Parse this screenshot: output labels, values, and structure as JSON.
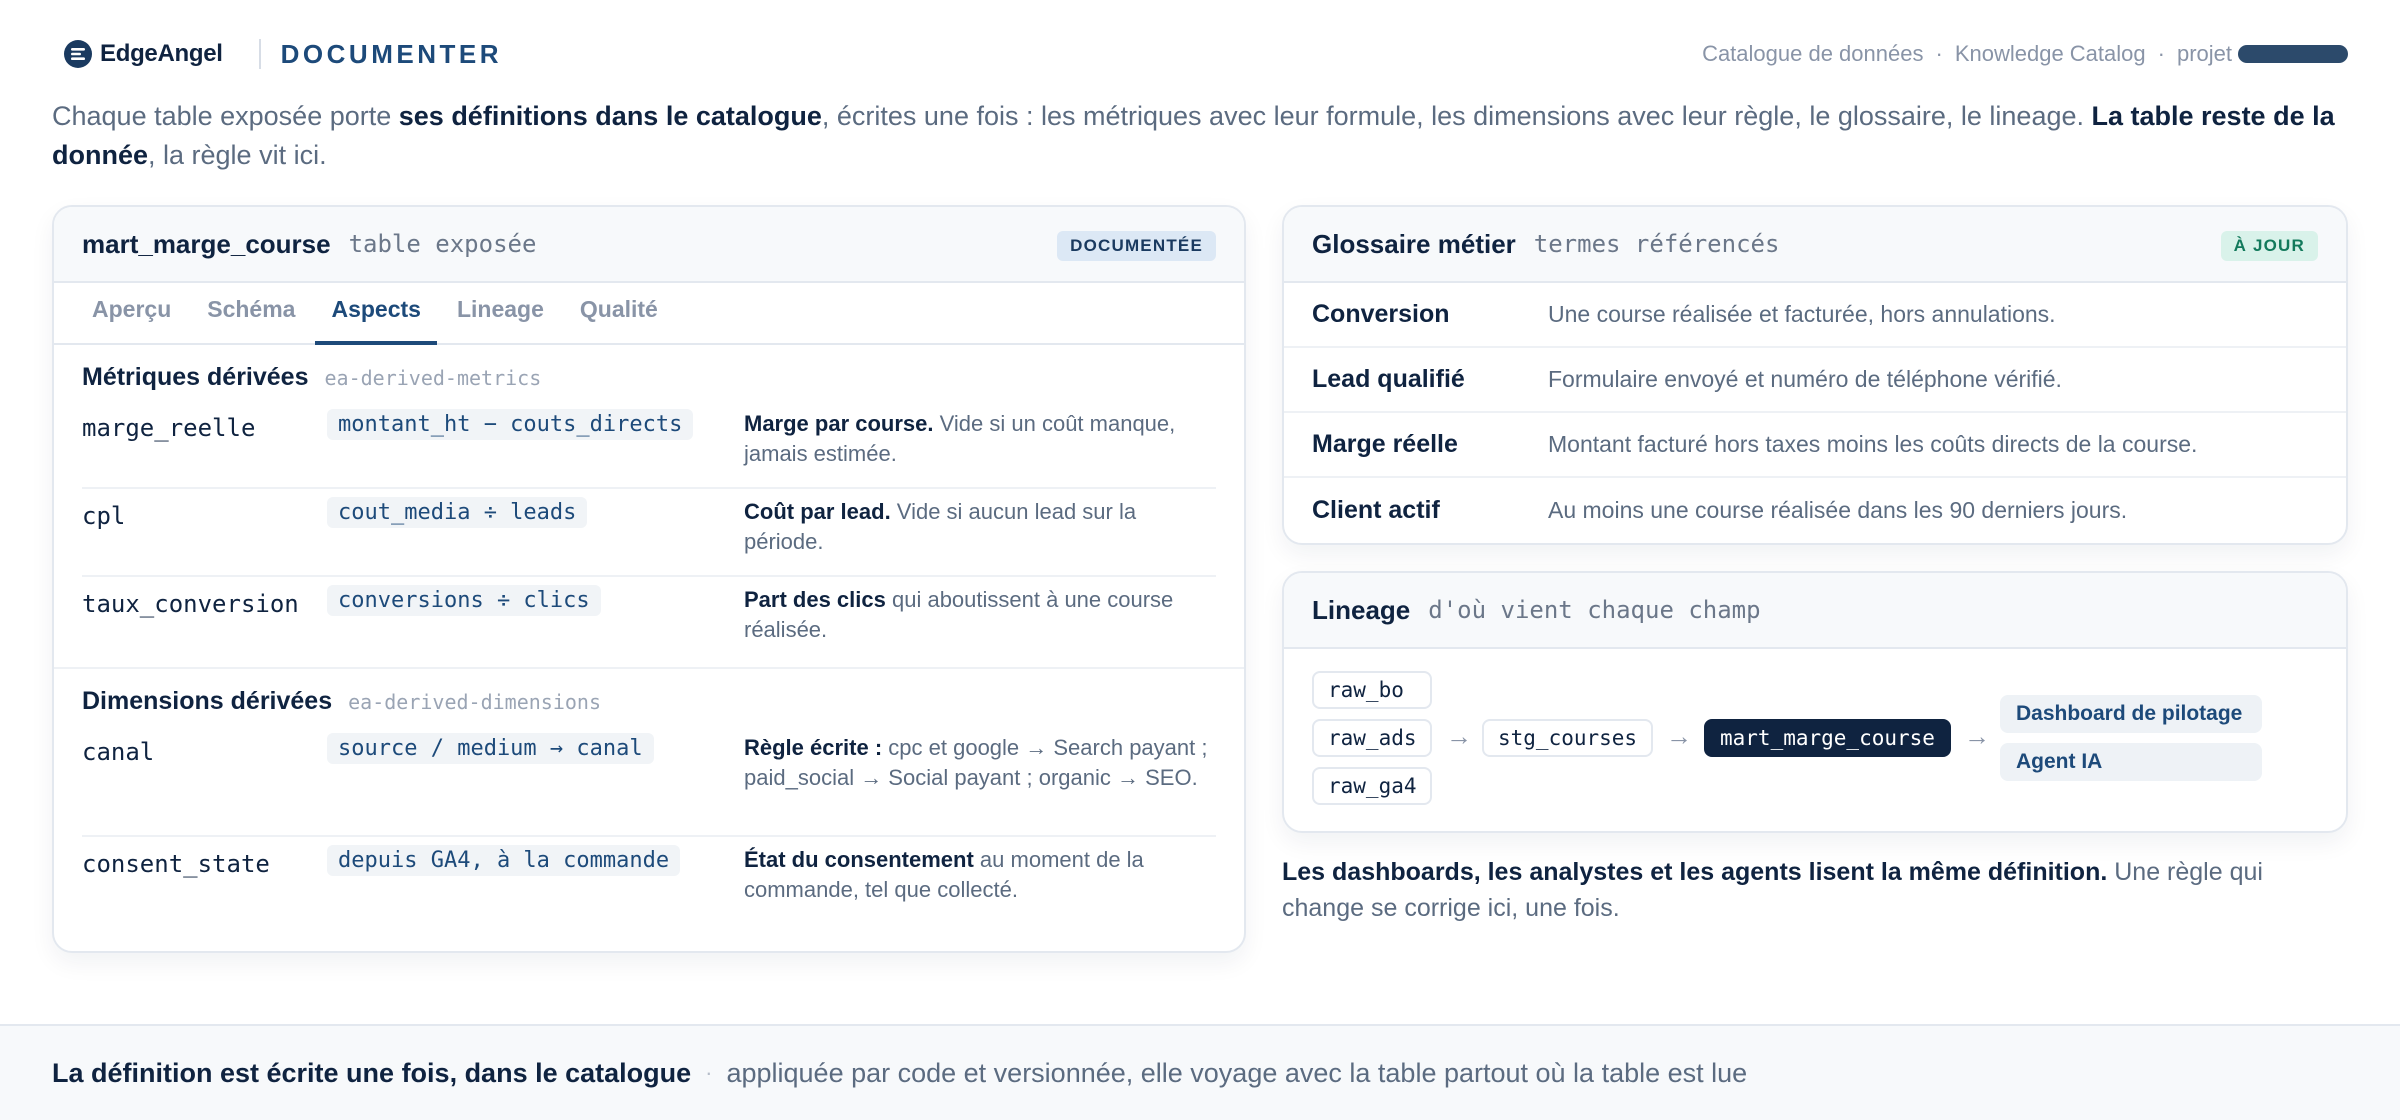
{
  "header": {
    "brand": "EdgeAngel",
    "product": "DOCUMENTER",
    "breadcrumb": [
      "Catalogue de données",
      "Knowledge Catalog",
      "projet"
    ],
    "brand_icon": "edgeangel-logo-icon"
  },
  "intro": {
    "p1": "Chaque table exposée porte ",
    "b1": "ses définitions dans le catalogue",
    "p2": ", écrites une fois : les métriques avec leur formule, les dimensions avec leur règle, le glossaire, le lineage. ",
    "b2": "La table reste de la donnée",
    "p3": ", la règle vit ici."
  },
  "table_card": {
    "title": "mart_marge_course",
    "subtitle": "table exposée",
    "badge": "DOCUMENTÉE",
    "badge_color": "#dce8f5",
    "tabs": [
      "Aperçu",
      "Schéma",
      "Aspects",
      "Lineage",
      "Qualité"
    ],
    "active_tab": "Aspects",
    "metrics": {
      "title": "Métriques dérivées",
      "key": "ea-derived-metrics",
      "rows": [
        {
          "name": "marge_reelle",
          "formula": "montant_ht − couts_directs",
          "desc_bold": "Marge par course.",
          "desc": " Vide si un coût manque, jamais estimée."
        },
        {
          "name": "cpl",
          "formula": "cout_media ÷ leads",
          "desc_bold": "Coût par lead.",
          "desc": " Vide si aucun lead sur la période."
        },
        {
          "name": "taux_conversion",
          "formula": "conversions ÷ clics",
          "desc_bold": "Part des clics",
          "desc": " qui aboutissent à une course réalisée."
        }
      ]
    },
    "dimensions": {
      "title": "Dimensions dérivées",
      "key": "ea-derived-dimensions",
      "rows": [
        {
          "name": "canal",
          "formula": "source / medium → canal",
          "desc_bold": "Règle écrite :",
          "desc": " cpc et google → Search payant ; paid_social → Social payant ; organic → SEO."
        },
        {
          "name": "consent_state",
          "formula": "depuis GA4, à la commande",
          "desc_bold": "État du consentement",
          "desc": " au moment de la commande, tel que collecté."
        }
      ]
    }
  },
  "glossary": {
    "title": "Glossaire métier",
    "subtitle": "termes référencés",
    "badge": "À JOUR",
    "badge_color": "#d9f2ea",
    "terms": [
      {
        "term": "Conversion",
        "def": "Une course réalisée et facturée, hors annulations."
      },
      {
        "term": "Lead qualifié",
        "def": "Formulaire envoyé et numéro de téléphone vérifié."
      },
      {
        "term": "Marge réelle",
        "def": "Montant facturé hors taxes moins les coûts directs de la course."
      },
      {
        "term": "Client actif",
        "def": "Au moins une course réalisée dans les 90 derniers jours."
      }
    ]
  },
  "lineage": {
    "title": "Lineage",
    "subtitle": "d'où vient chaque champ",
    "sources": [
      "raw_bo",
      "raw_ads",
      "raw_ga4"
    ],
    "staging": "stg_courses",
    "mart": "mart_marge_course",
    "outputs": [
      "Dashboard de pilotage",
      "Agent IA"
    ],
    "arrow": "→",
    "note_bold": "Les dashboards, les analystes et les agents lisent la même définition.",
    "note": " Une règle qui change se corrige ici, une fois."
  },
  "footer": {
    "bold": "La définition est écrite une fois, dans le catalogue",
    "sep": "·",
    "text": "appliquée par code et versionnée, elle voyage avec la table partout où la table est lue"
  }
}
